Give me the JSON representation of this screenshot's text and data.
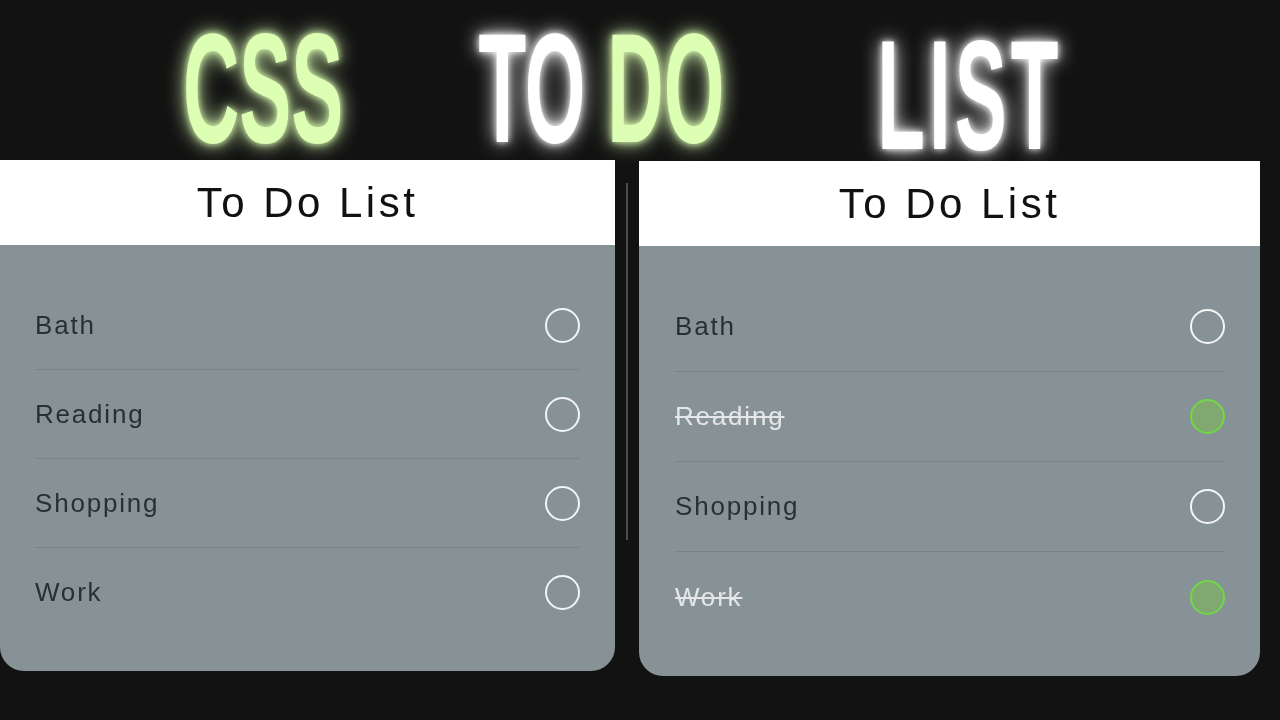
{
  "headline": {
    "words": [
      {
        "text": "CSS",
        "color": "#dcffb4"
      },
      {
        "text": "TO",
        "color": "#ffffff"
      },
      {
        "text": "DO",
        "color": "#dcffb4"
      },
      {
        "text": "LIST",
        "color": "#ffffff"
      }
    ]
  },
  "panels": [
    {
      "title": "To Do List",
      "items": [
        {
          "label": "Bath",
          "checked": false
        },
        {
          "label": "Reading",
          "checked": false
        },
        {
          "label": "Shopping",
          "checked": false
        },
        {
          "label": "Work",
          "checked": false
        }
      ]
    },
    {
      "title": "To Do List",
      "items": [
        {
          "label": "Bath",
          "checked": false
        },
        {
          "label": "Reading",
          "checked": true
        },
        {
          "label": "Shopping",
          "checked": false
        },
        {
          "label": "Work",
          "checked": true
        }
      ]
    }
  ]
}
